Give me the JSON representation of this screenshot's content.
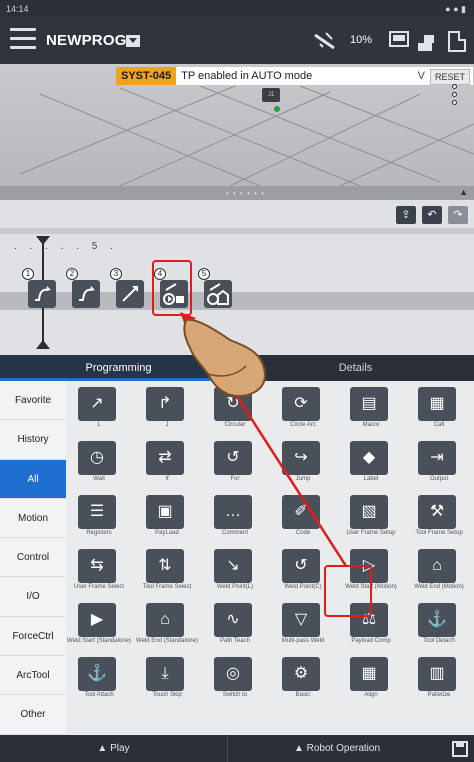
{
  "status": {
    "time": "14:14",
    "right": "● ● ▮"
  },
  "title": {
    "program": "NEWPROG",
    "speed": "10%"
  },
  "alarm": {
    "code": "SYST-045",
    "message": "TP enabled in AUTO mode",
    "reset": "RESET",
    "chevron": "V"
  },
  "viewer": {
    "frame_label": "J1"
  },
  "editor": {
    "timeline": ". . . . . 5 .",
    "nodes": [
      "1",
      "2",
      "3",
      "4",
      "5"
    ]
  },
  "tabs": [
    "Programming",
    "Details"
  ],
  "categories": [
    "Favorite",
    "History",
    "All",
    "Motion",
    "Control",
    "I/O",
    "ForceCtrl",
    "ArcTool",
    "Other"
  ],
  "active_category": "All",
  "instructions": [
    {
      "label": "L",
      "icon": "linear-motion-icon"
    },
    {
      "label": "J",
      "icon": "joint-motion-icon"
    },
    {
      "label": "Circular",
      "icon": "circular-motion-icon"
    },
    {
      "label": "Circle Arc",
      "icon": "circle-arc-icon"
    },
    {
      "label": "Macro",
      "icon": "macro-icon"
    },
    {
      "label": "Call",
      "icon": "call-icon"
    },
    {
      "label": "Wait",
      "icon": "wait-icon"
    },
    {
      "label": "If",
      "icon": "if-icon"
    },
    {
      "label": "For",
      "icon": "for-icon"
    },
    {
      "label": "Jump",
      "icon": "jump-icon"
    },
    {
      "label": "Label",
      "icon": "label-icon"
    },
    {
      "label": "Output",
      "icon": "output-icon"
    },
    {
      "label": "Registers",
      "icon": "registers-icon"
    },
    {
      "label": "PayLoad",
      "icon": "payload-icon"
    },
    {
      "label": "Comment",
      "icon": "comment-icon"
    },
    {
      "label": "Code",
      "icon": "code-icon"
    },
    {
      "label": "User Frame Setup",
      "icon": "user-frame-setup-icon"
    },
    {
      "label": "Tool Frame Setup",
      "icon": "tool-frame-setup-icon"
    },
    {
      "label": "User Frame Select",
      "icon": "user-frame-select-icon"
    },
    {
      "label": "Tool Frame Select",
      "icon": "tool-frame-select-icon"
    },
    {
      "label": "Weld Point(L)",
      "icon": "weld-point-l-icon"
    },
    {
      "label": "Weld Point(C)",
      "icon": "weld-point-c-icon"
    },
    {
      "label": "Weld Start (Motion)",
      "icon": "weld-start-motion-icon"
    },
    {
      "label": "Weld End (Motion)",
      "icon": "weld-end-motion-icon"
    },
    {
      "label": "Weld Start (Standalone)",
      "icon": "weld-start-standalone-icon"
    },
    {
      "label": "Weld End (Standalone)",
      "icon": "weld-end-standalone-icon"
    },
    {
      "label": "Path Teach",
      "icon": "path-teach-icon"
    },
    {
      "label": "Multi-pass Weld",
      "icon": "multipass-weld-icon"
    },
    {
      "label": "Payload Comp",
      "icon": "payload-comp-icon"
    },
    {
      "label": "Tool Detach",
      "icon": "tool-detach-icon"
    },
    {
      "label": "Tool Attach",
      "icon": "tool-attach-icon"
    },
    {
      "label": "Touch Skip",
      "icon": "touch-skip-icon"
    },
    {
      "label": "Switch to",
      "icon": "switch-to-icon"
    },
    {
      "label": "Basic",
      "icon": "basic-icon"
    },
    {
      "label": "Align",
      "icon": "align-icon"
    },
    {
      "label": "Palletize",
      "icon": "palletize-icon"
    }
  ],
  "bottom": {
    "play": "▲ Play",
    "robot_operation": "▲ Robot Operation"
  },
  "colors": {
    "accent": "#1e6fd0",
    "highlight": "#e21b1b",
    "alarm": "#f0a41c"
  }
}
